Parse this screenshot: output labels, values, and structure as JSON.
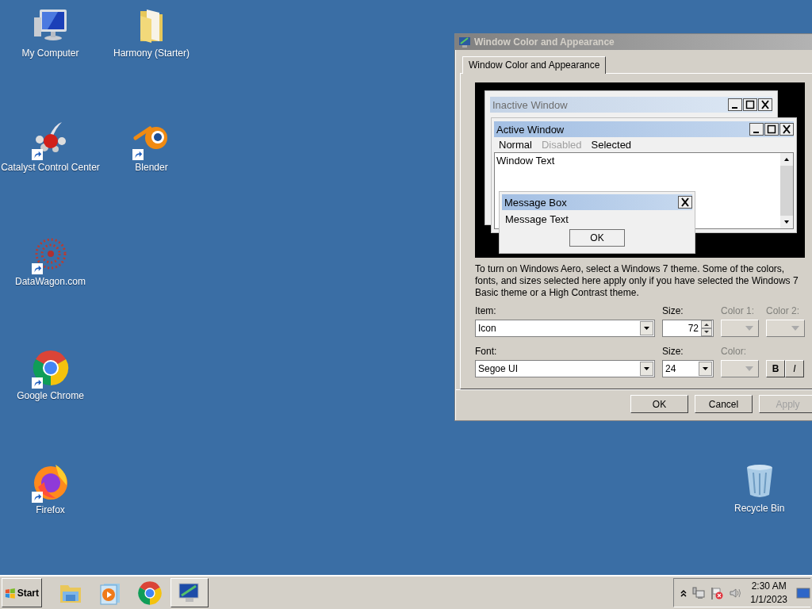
{
  "desktop_icons": [
    {
      "label": "My Computer",
      "kind": "computer",
      "shortcut": false
    },
    {
      "label": "Catalyst Control Center",
      "kind": "catalyst",
      "shortcut": true
    },
    {
      "label": "DataWagon.com",
      "kind": "datawagon",
      "shortcut": true
    },
    {
      "label": "Google Chrome",
      "kind": "chrome",
      "shortcut": true
    },
    {
      "label": "Firefox",
      "kind": "firefox",
      "shortcut": true
    },
    {
      "label": "Harmony (Starter)",
      "kind": "folder",
      "shortcut": false
    },
    {
      "label": "Blender",
      "kind": "blender",
      "shortcut": true
    }
  ],
  "recycle_bin": {
    "label": "Recycle Bin",
    "kind": "recycle"
  },
  "dialog": {
    "title": "Window Color and Appearance",
    "active": false,
    "tabs": [
      {
        "label": "Window Color and Appearance",
        "selected": true
      }
    ],
    "preview": {
      "inactive_title": "Inactive Window",
      "active_title": "Active Window",
      "menu": [
        {
          "label": "Normal",
          "disabled": false
        },
        {
          "label": "Disabled",
          "disabled": true
        },
        {
          "label": "Selected",
          "disabled": false
        }
      ],
      "window_text": "Window Text",
      "message_title": "Message Box",
      "message_text": "Message Text",
      "message_button": "OK"
    },
    "description": "To turn on Windows Aero, select a Windows 7 theme.  Some of the colors, fonts, and sizes selected here apply only if you have selected the Windows 7 Basic theme or a High Contrast theme.",
    "rows": [
      [
        {
          "kind": "select",
          "label": "Item:",
          "value": "Icon",
          "disabled": false
        },
        {
          "kind": "spin",
          "label": "Size:",
          "value": "72",
          "disabled": false
        },
        {
          "kind": "color",
          "label": "Color 1:",
          "disabled": true
        },
        {
          "kind": "color",
          "label": "Color 2:",
          "disabled": true
        }
      ],
      [
        {
          "kind": "select",
          "label": "Font:",
          "value": "Segoe UI",
          "disabled": false
        },
        {
          "kind": "select",
          "label": "Size:",
          "value": "24",
          "disabled": false
        },
        {
          "kind": "color",
          "label": "Color:",
          "disabled": true
        },
        {
          "kind": "style",
          "buttons": [
            {
              "label": "B",
              "kind": "bold"
            },
            {
              "label": "I",
              "kind": "italic"
            }
          ]
        }
      ]
    ],
    "buttons": [
      {
        "label": "OK",
        "disabled": false
      },
      {
        "label": "Cancel",
        "disabled": false
      },
      {
        "label": "Apply",
        "disabled": true
      }
    ]
  },
  "taskbar": {
    "start": "Start",
    "apps": [
      {
        "kind": "explorer",
        "active": false
      },
      {
        "kind": "media",
        "active": false
      },
      {
        "kind": "chrome",
        "active": false
      },
      {
        "kind": "display",
        "active": true
      }
    ],
    "time": "2:30 AM",
    "date": "1/1/2023"
  }
}
